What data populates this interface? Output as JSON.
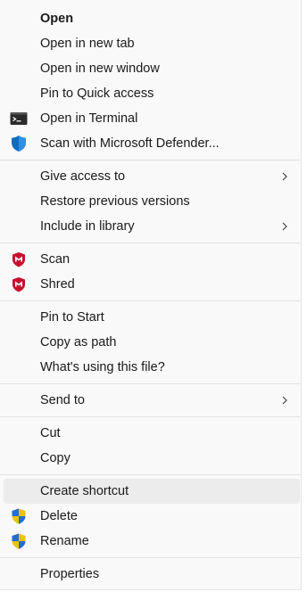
{
  "menu": {
    "open": "Open",
    "open_new_tab": "Open in new tab",
    "open_new_window": "Open in new window",
    "pin_quick_access": "Pin to Quick access",
    "open_terminal": "Open in Terminal",
    "scan_defender": "Scan with Microsoft Defender...",
    "give_access": "Give access to",
    "restore_versions": "Restore previous versions",
    "include_library": "Include in library",
    "scan": "Scan",
    "shred": "Shred",
    "pin_start": "Pin to Start",
    "copy_path": "Copy as path",
    "whats_using": "What's using this file?",
    "send_to": "Send to",
    "cut": "Cut",
    "copy": "Copy",
    "create_shortcut": "Create shortcut",
    "delete": "Delete",
    "rename": "Rename",
    "properties": "Properties"
  },
  "colors": {
    "menu_bg": "#f9f9f9",
    "hover_bg": "#ececec",
    "separator": "#e2e2e2",
    "mcafee_red": "#c8102e",
    "defender_blue": "#0f6cbd"
  },
  "icons": {
    "terminal": "terminal-icon",
    "defender": "defender-shield-icon",
    "mcafee": "mcafee-shield-icon",
    "uac": "uac-shield-icon",
    "submenu": "chevron-right-icon"
  },
  "hovered_item": "create_shortcut"
}
